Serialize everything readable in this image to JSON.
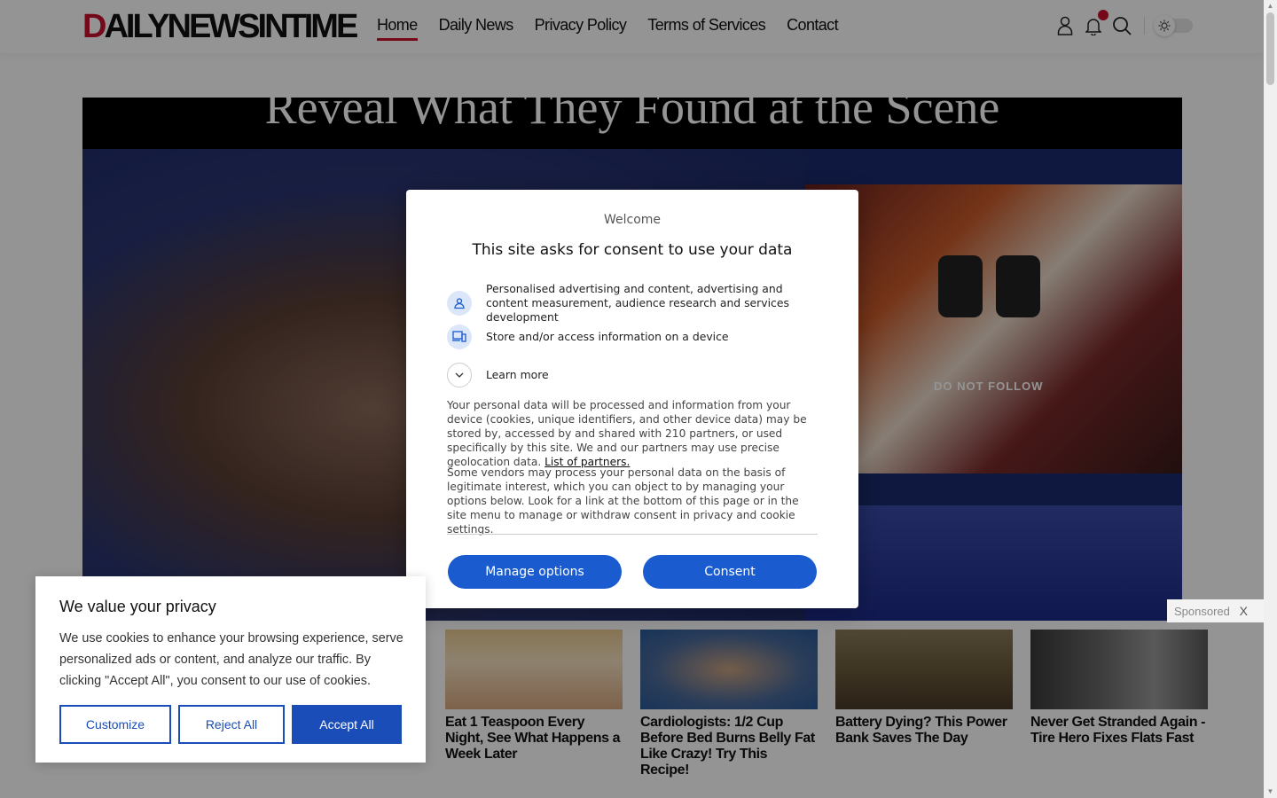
{
  "header": {
    "logo_first": "D",
    "logo_rest": "AILYNEWSINTIME",
    "nav": [
      {
        "label": "Home",
        "active": true
      },
      {
        "label": "Daily News"
      },
      {
        "label": "Privacy Policy"
      },
      {
        "label": "Terms of Services"
      },
      {
        "label": "Contact"
      }
    ],
    "icons": [
      "user-icon",
      "bell-icon",
      "search-icon",
      "sun-icon"
    ]
  },
  "hero": {
    "headline": "Reveal What They Found at the Scene",
    "caption": "DO NOT   FOLLOW"
  },
  "consent_modal": {
    "welcome": "Welcome",
    "title": "This site asks for consent to use your data",
    "items": [
      {
        "icon": "person-icon",
        "text": "Personalised advertising and content, advertising and content measurement, audience research and services development"
      },
      {
        "icon": "devices-icon",
        "text": "Store and/or access information on a device"
      },
      {
        "icon": "chevron-down-icon",
        "text": "Learn more"
      }
    ],
    "para1": "Your personal data will be processed and information from your device (cookies, unique identifiers, and other device data) may be stored by, accessed by and shared with 210 partners, or used specifically by this site. We and our partners may use precise geolocation data.",
    "partners_link": "List of partners.",
    "para2": "Some vendors may process your personal data on the basis of legitimate interest, which you can object to by managing your options below. Look for a link at the bottom of this page or in the site menu to manage or withdraw consent in privacy and cookie settings.",
    "manage_label": "Manage options",
    "consent_label": "Consent"
  },
  "cookie_banner": {
    "title": "We value your privacy",
    "text": "We use cookies to enhance your browsing experience, serve personalized ads or content, and analyze our traffic. By clicking \"Accept All\", you consent to our use of cookies.",
    "customize": "Customize",
    "reject": "Reject All",
    "accept": "Accept All"
  },
  "sponsored": {
    "label": "Sponsored",
    "close": "X",
    "ads": [
      {
        "title": "Eat 1 Teaspoon Every Night, See What Happens a Week Later"
      },
      {
        "title": "Cardiologists: 1/2 Cup Before Bed Burns Belly Fat Like Crazy! Try This Recipe!"
      },
      {
        "title": "Battery Dying? This Power Bank Saves The Day"
      },
      {
        "title": "Never Get Stranded Again - Tire Hero Fixes Flats Fast"
      }
    ]
  },
  "colors": {
    "brand_red": "#c8102e",
    "consent_blue": "#1a5ccf",
    "cookie_blue": "#1a4db8"
  }
}
